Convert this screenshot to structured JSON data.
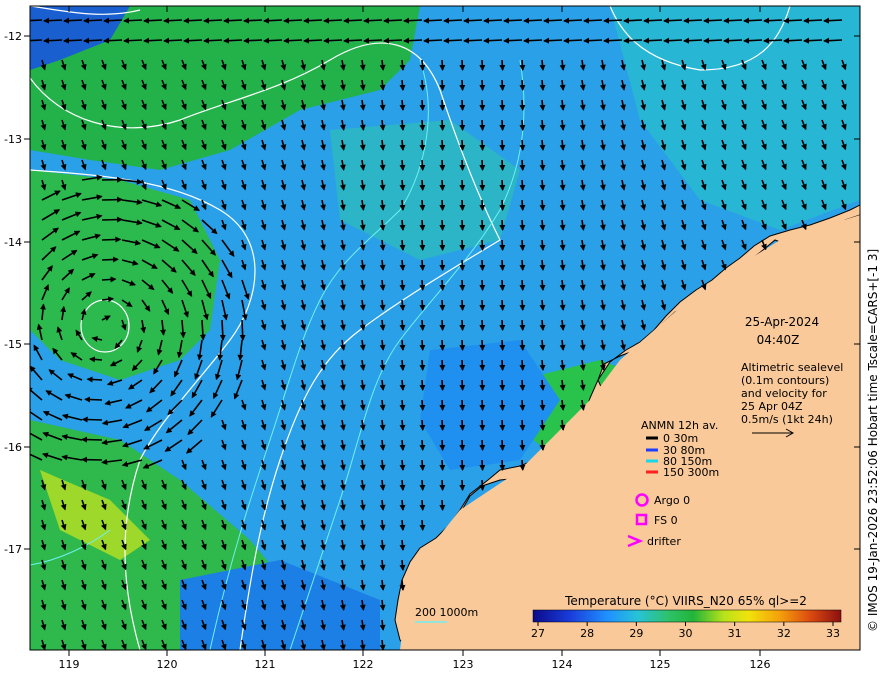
{
  "map": {
    "x_axis_ticks": [
      "119",
      "120",
      "121",
      "122",
      "123",
      "124",
      "125",
      "126"
    ],
    "y_axis_ticks": [
      "-12",
      "-13",
      "-14",
      "-15",
      "-16",
      "-17"
    ],
    "date": "25-Apr-2024",
    "time": "04:40Z",
    "altimetry_lines": [
      "Altimetric sealevel",
      "(0.1m contours)",
      "and velocity for",
      "25 Apr 04Z",
      "0.5m/s (1kt 24h)"
    ],
    "legend_title": "ANMN 12h av.",
    "legend_items": [
      {
        "label": "0 30m",
        "color": "#000000"
      },
      {
        "label": "30 80m",
        "color": "#1f3fff"
      },
      {
        "label": "80 150m",
        "color": "#19d7e8"
      },
      {
        "label": "150 300m",
        "color": "#ff2020"
      }
    ],
    "argo_label": "Argo 0",
    "fs_label": "FS 0",
    "drifter_label": "drifter",
    "marker_color": "#ff00ff",
    "isobath_label": "200 1000m",
    "colorbar_title": "Temperature (°C) VIIRS_N20 65% ql>=2",
    "colorbar_ticks": [
      "27",
      "28",
      "29",
      "30",
      "31",
      "32",
      "33"
    ],
    "colorbar_colors": [
      "#0b0b8a",
      "#1a3cd9",
      "#1f90ff",
      "#27c3d8",
      "#2ec26a",
      "#22b43a",
      "#b8e21a",
      "#f2e20b",
      "#f4a10b",
      "#dc4a10",
      "#8b1010"
    ],
    "credit": "© IMOS 19-Jan-2026 23:52:06 Hobart time Tscale=CARS+[-1 3]",
    "land_color": "#f9c99a",
    "ocean_green": "#21b04e",
    "ocean_blue": "#2aa0e8"
  }
}
